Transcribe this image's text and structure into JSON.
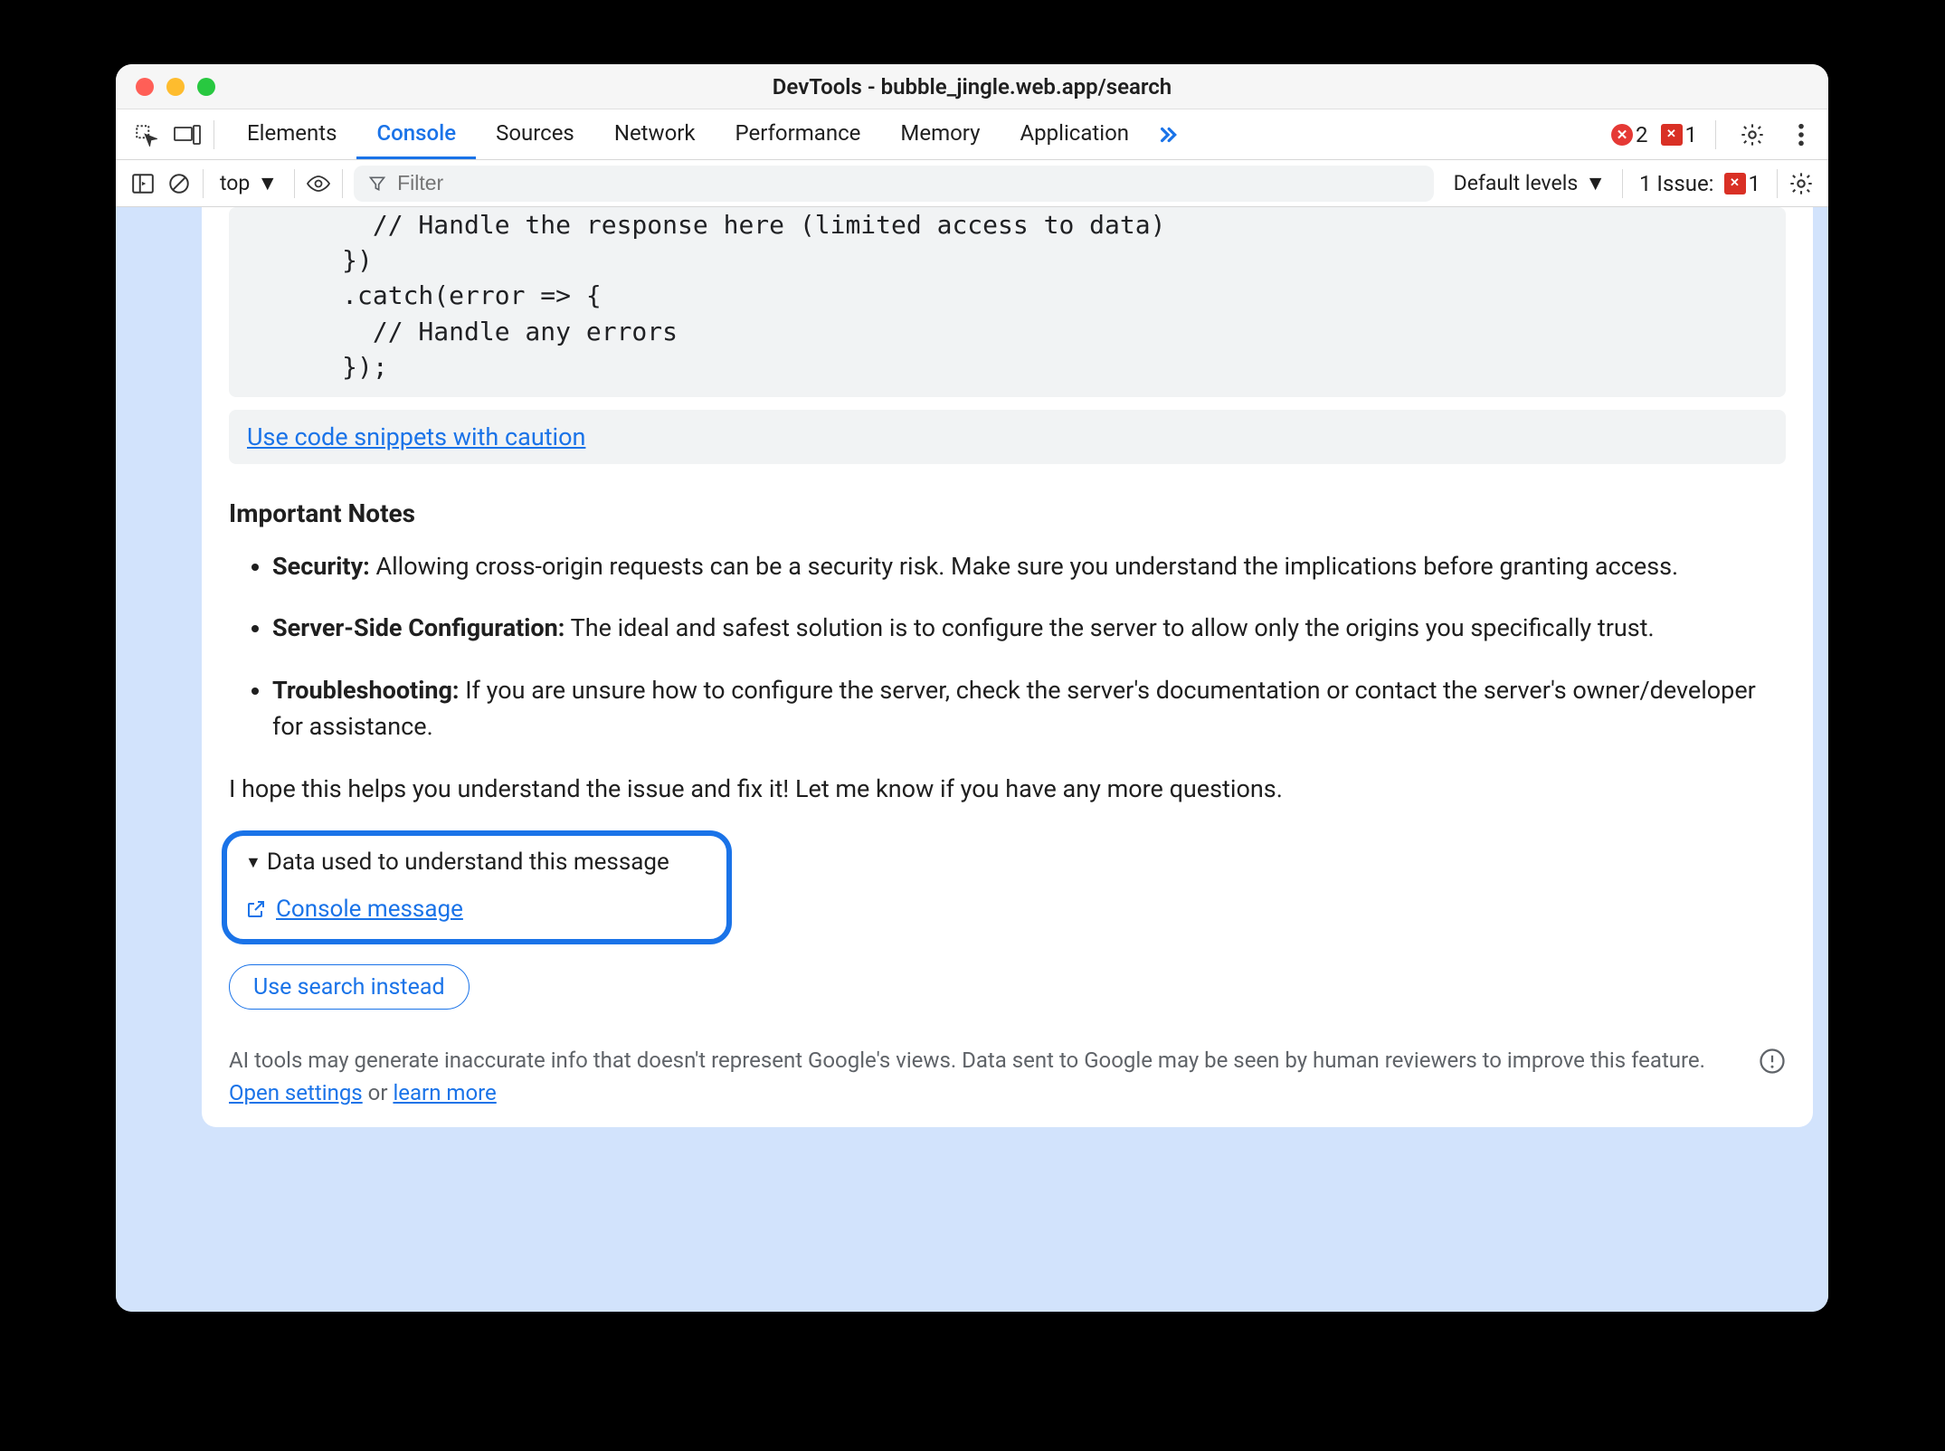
{
  "window": {
    "title": "DevTools - bubble_jingle.web.app/search"
  },
  "tabs": {
    "items": [
      "Elements",
      "Console",
      "Sources",
      "Network",
      "Performance",
      "Memory",
      "Application"
    ],
    "active": "Console",
    "errors_count": "2",
    "issues_count": "1"
  },
  "filter": {
    "context": "top",
    "placeholder": "Filter",
    "levels": "Default levels",
    "issue_label": "1 Issue:",
    "issue_count": "1"
  },
  "code": "        // Handle the response here (limited access to data)\n      })\n      .catch(error => {\n        // Handle any errors\n      });",
  "caution_link": "Use code snippets with caution",
  "notes_title": "Important Notes",
  "notes": {
    "n1b": "Security:",
    "n1": " Allowing cross-origin requests can be a security risk. Make sure you understand the implications before granting access.",
    "n2b": "Server-Side Configuration:",
    "n2": " The ideal and safest solution is to configure the server to allow only the origins you specifically trust.",
    "n3b": "Troubleshooting:",
    "n3": " If you are unsure how to configure the server, check the server's documentation or contact the server's owner/developer for assistance."
  },
  "closing": "I hope this helps you understand the issue and fix it! Let me know if you have any more questions.",
  "disclosure": {
    "label": "Data used to understand this message",
    "link": "Console message"
  },
  "search_btn": "Use search instead",
  "disclaimer": {
    "t1": "AI tools may generate inaccurate info that doesn't represent Google's views. Data sent to Google may be seen by human reviewers to improve this feature. ",
    "link1": "Open settings",
    "t2": " or ",
    "link2": "learn more"
  }
}
